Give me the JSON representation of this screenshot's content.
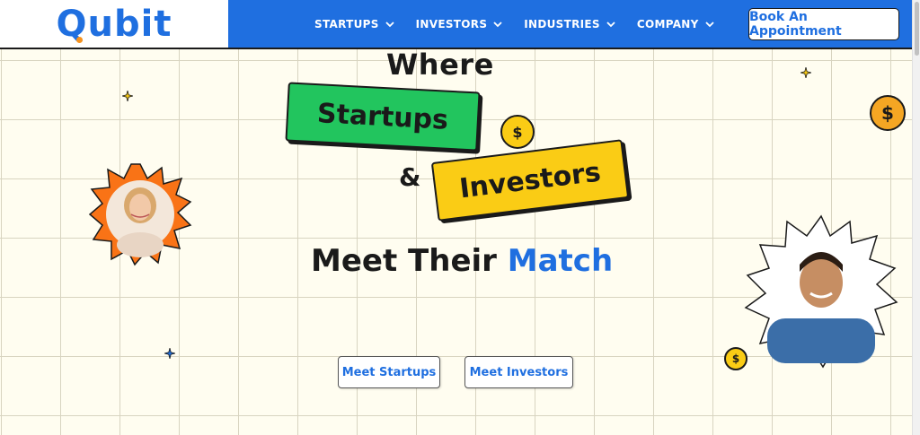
{
  "header": {
    "logo_text": "Qubit",
    "nav": [
      {
        "label": "STARTUPS"
      },
      {
        "label": "INVESTORS"
      },
      {
        "label": "INDUSTRIES"
      },
      {
        "label": "COMPANY"
      }
    ],
    "book_button": "Book An Appointment"
  },
  "hero": {
    "line1": "Where",
    "tag_startups": "Startups",
    "ampersand": "&",
    "tag_investors": "Investors",
    "headline_prefix": "Meet Their ",
    "headline_accent": "Match",
    "cta_startups": "Meet Startups",
    "cta_investors": "Meet Investors",
    "coin_symbol": "$"
  },
  "icons": {
    "chevron": "chevron-down-icon",
    "coin": "dollar-coin-icon",
    "sparkle": "sparkle-icon"
  },
  "colors": {
    "brand_blue": "#1f6fe0",
    "green": "#22c55e",
    "yellow": "#facc15",
    "orange": "#f7931e",
    "hero_bg": "#fffdf0"
  }
}
